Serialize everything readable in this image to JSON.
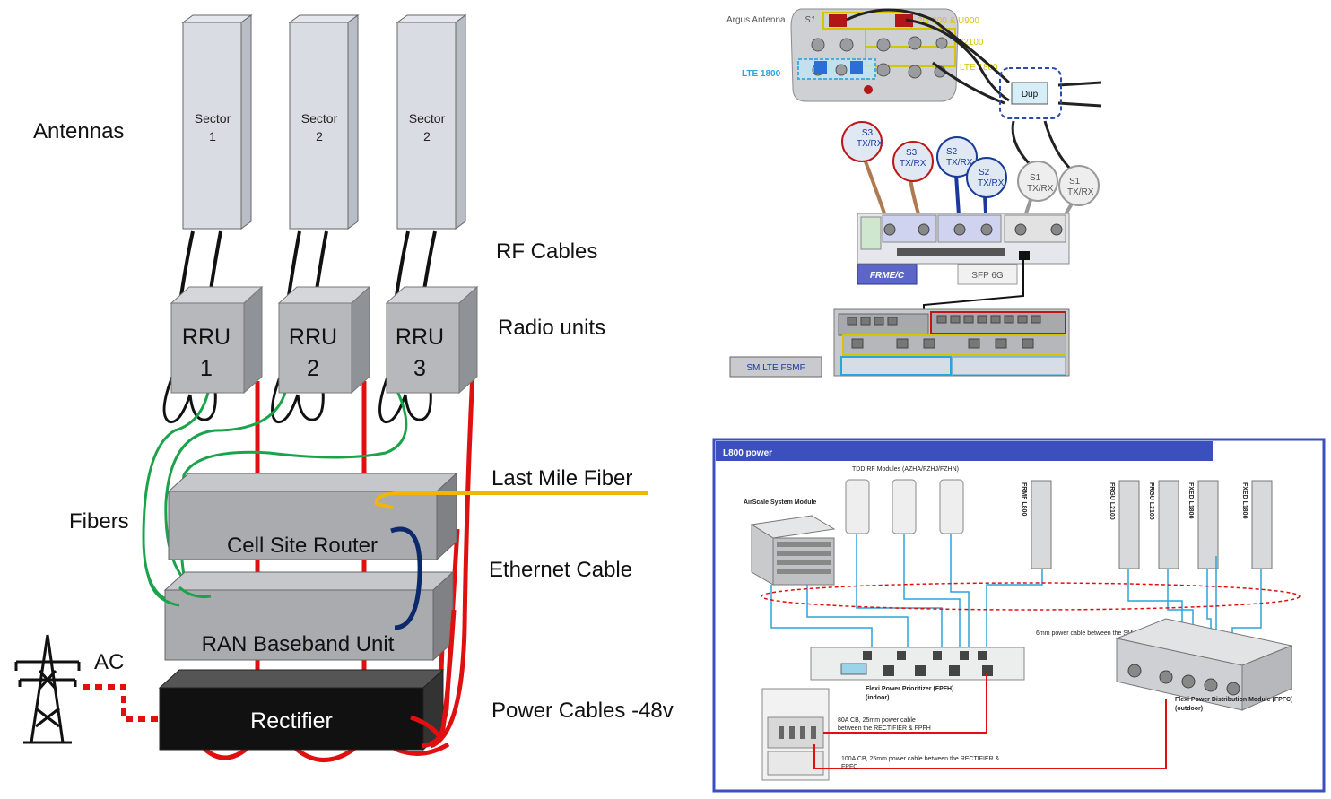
{
  "left_diagram": {
    "antennas_label": "Antennas",
    "rf_cables_label": "RF Cables",
    "radio_units_label": "Radio units",
    "fibers_label": "Fibers",
    "last_mile_fiber_label": "Last Mile Fiber",
    "ethernet_cable_label": "Ethernet Cable",
    "ac_label": "AC",
    "power_cables_label": "Power Cables -48v",
    "sectors": [
      {
        "line1": "Sector",
        "line2": "1"
      },
      {
        "line1": "Sector",
        "line2": "2"
      },
      {
        "line1": "Sector",
        "line2": "2"
      }
    ],
    "rrus": [
      {
        "line1": "RRU",
        "line2": "1"
      },
      {
        "line1": "RRU",
        "line2": "2"
      },
      {
        "line1": "RRU",
        "line2": "3"
      }
    ],
    "cell_site_router": "Cell Site Router",
    "ran_baseband_unit": "RAN Baseband Unit",
    "rectifier": "Rectifier"
  },
  "top_right": {
    "argus_label": "Argus Antenna",
    "s1": "S1",
    "band_labels": [
      "2G 900 & U900",
      "U2100",
      "LTE 1800"
    ],
    "lte1800_label": "LTE 1800",
    "dup_label": "Dup",
    "ports": [
      {
        "s": "S3",
        "t": "TX/RX"
      },
      {
        "s": "S3",
        "t": "TX/RX"
      },
      {
        "s": "S2",
        "t": "TX/RX"
      },
      {
        "s": "S2",
        "t": "TX/RX"
      },
      {
        "s": "S1",
        "t": "TX/RX"
      },
      {
        "s": "S1",
        "t": "TX/RX"
      }
    ],
    "frme_label": "FRME/C",
    "sfp_label": "SFP 6G",
    "sm_label": "SM LTE FSMF"
  },
  "bottom_right": {
    "title": "L800 power",
    "tdd_label": "TDD RF Modules (AZHA/FZHJ/FZHN)",
    "airscale_label": "AirScale System Module",
    "rf_modules": [
      "FRMF L800",
      "FRGU L2100",
      "FRGU L2100",
      "FXED L1800",
      "FXED L1800"
    ],
    "six_mm_note": "6mm power cable between the SM, RPMs & FPFH/FPFC",
    "fpfh_label": "Flexi Power Prioritizer (FPFH)",
    "fpfh_sub": "(indoor)",
    "fpfc_label": "Flexi Power Distribution Module (FPFC)",
    "fpfc_sub": "(outdoor)",
    "note80_l1": "80A CB, 25mm power cable",
    "note80_l2": "between the RECTIFIER & FPFH",
    "note100_l1": "100A CB, 25mm power cable between the RECTIFIER &",
    "note100_l2": "FPFC"
  },
  "colors": {
    "fiber": "#1aa34a",
    "power": "#e01010",
    "lastmile": "#f5b400",
    "ethernet": "#0c2a6b",
    "frame_blue": "#3b4fbf",
    "cable_blue": "#2aa4dc"
  }
}
